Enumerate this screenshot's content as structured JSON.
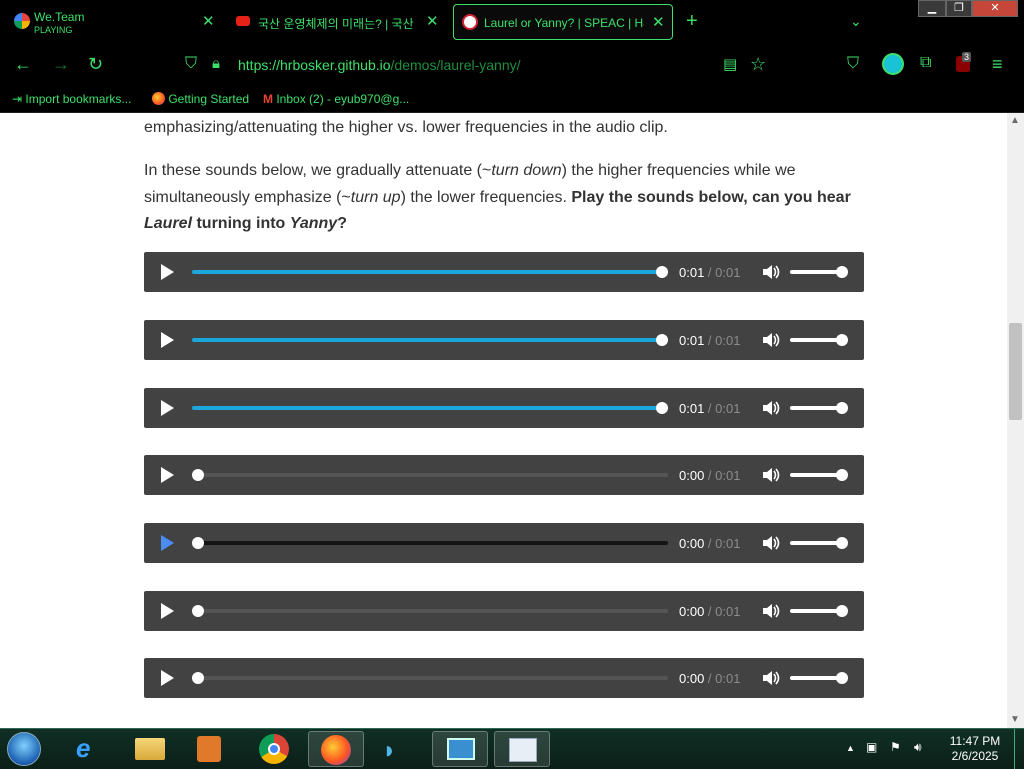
{
  "browser": {
    "tabs": [
      {
        "title": "We.Team",
        "subtitle": "PLAYING"
      },
      {
        "title": "국산 운영체제의 미래는? | 국산"
      },
      {
        "title": "Laurel or Yanny? | SPEAC | Hans"
      }
    ],
    "new_tab": "+",
    "url_host": "https://hrbosker.github.io",
    "url_path": "/demos/laurel-yanny/",
    "bookmarks": [
      {
        "label": "Import bookmarks..."
      },
      {
        "label": "Getting Started"
      },
      {
        "label": "Inbox (2) - eyub970@g..."
      }
    ],
    "extension_badge": "3",
    "accent_color": "#3ee06a"
  },
  "page": {
    "para1": "emphasizing/attenuating the higher vs. lower frequencies in the audio clip.",
    "para2": {
      "t1": "In these sounds below, we gradually attenuate (~",
      "t2": "turn down",
      "t3": ") the higher frequencies while we simultaneously emphasize (~",
      "t4": "turn up",
      "t5": ") the lower frequencies. ",
      "b1": "Play the sounds below, can you hear ",
      "b2": "Laurel",
      "b3": " turning into ",
      "b4": "Yanny",
      "b5": "?"
    },
    "players": [
      {
        "current": "0:01",
        "sep": " / ",
        "total": "0:01",
        "progress": 1.0
      },
      {
        "current": "0:01",
        "sep": " / ",
        "total": "0:01",
        "progress": 1.0
      },
      {
        "current": "0:01",
        "sep": " / ",
        "total": "0:01",
        "progress": 1.0
      },
      {
        "current": "0:00",
        "sep": " / ",
        "total": "0:01",
        "progress": 0.0
      },
      {
        "current": "0:00",
        "sep": " / ",
        "total": "0:01",
        "progress": 0.0
      },
      {
        "current": "0:00",
        "sep": " / ",
        "total": "0:01",
        "progress": 0.0
      },
      {
        "current": "0:00",
        "sep": " / ",
        "total": "0:01",
        "progress": 0.0
      }
    ],
    "player_accent": "#19a7dc"
  },
  "taskbar": {
    "time": "11:47 PM",
    "date": "2/6/2025"
  }
}
